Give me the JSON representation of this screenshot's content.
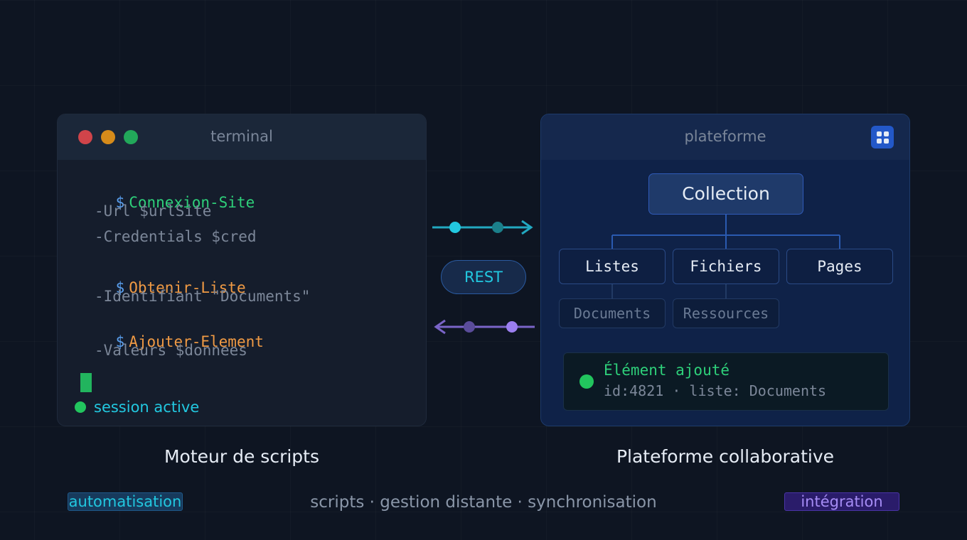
{
  "terminal": {
    "title": "terminal",
    "lines": [
      {
        "prompt": "$",
        "command": "Connexion-Site"
      },
      {
        "param": "-Url $urlSite"
      },
      {
        "param": "-Credentials $cred"
      },
      {
        "prompt": "$",
        "command": "Obtenir-Liste"
      },
      {
        "param": "-Identifiant \"Documents\""
      },
      {
        "prompt": "$",
        "command": "Ajouter-Element"
      },
      {
        "param": "-Valeurs $donnees"
      }
    ],
    "status": "session active"
  },
  "connector": {
    "label": "REST"
  },
  "platform": {
    "title": "plateforme",
    "root": "Collection",
    "children": [
      "Listes",
      "Fichiers",
      "Pages"
    ],
    "subchildren": [
      "Documents",
      "Ressources"
    ],
    "notification": {
      "title": "Élément ajouté",
      "detail": "id:4821 · liste: Documents"
    }
  },
  "labels": {
    "left": "Moteur de scripts",
    "right": "Plateforme collaborative"
  },
  "footer": {
    "tag_left": "automatisation",
    "tagline": "scripts · gestion distante · synchronisation",
    "tag_right": "intégration"
  },
  "colors": {
    "green": "#2ed07a",
    "orange": "#f09a44",
    "cyan": "#22c8e0",
    "purple": "#9b7ff0"
  }
}
